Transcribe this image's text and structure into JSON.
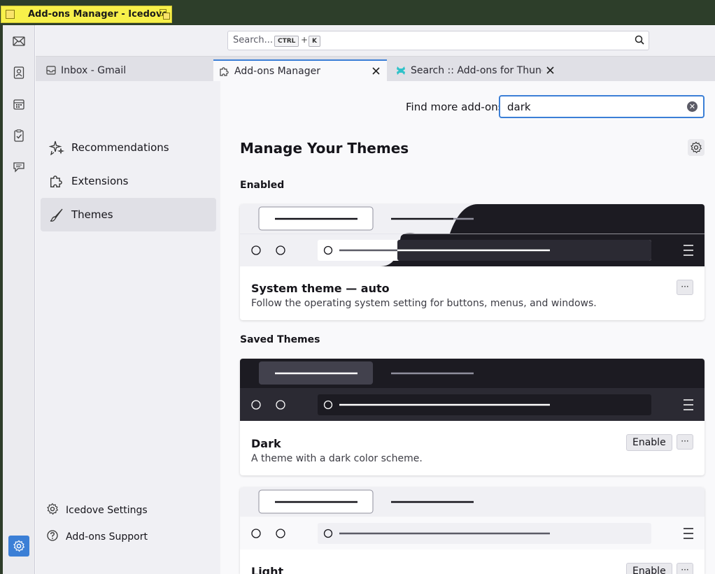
{
  "window": {
    "title": "Add-ons Manager - Icedove"
  },
  "spaces": [
    "mail-icon",
    "address-book-icon",
    "calendar-icon",
    "tasks-icon",
    "chat-icon",
    "settings-icon"
  ],
  "toolbar": {
    "search_placeholder": "Search...",
    "shortcut_key1": "CTRL",
    "shortcut_plus": "+",
    "shortcut_key2": "K"
  },
  "tabs": [
    {
      "label": "Inbox - Gmail",
      "icon": "inbox-icon"
    },
    {
      "label": "Add-ons Manager",
      "icon": "puzzle-icon",
      "active": true
    },
    {
      "label": "Search :: Add-ons for Thunderbird",
      "icon": "addons-site-icon"
    }
  ],
  "sidebar": {
    "categories": [
      {
        "label": "Recommendations",
        "icon": "sparkle-icon"
      },
      {
        "label": "Extensions",
        "icon": "puzzle-icon"
      },
      {
        "label": "Themes",
        "icon": "brush-icon",
        "selected": true
      }
    ],
    "footer": [
      {
        "label": "Icedove Settings",
        "icon": "gear-icon"
      },
      {
        "label": "Add-ons Support",
        "icon": "help-icon"
      }
    ]
  },
  "main": {
    "find_label": "Find more add-ons",
    "find_value": "dark",
    "heading": "Manage Your Themes",
    "enabled_heading": "Enabled",
    "saved_heading": "Saved Themes",
    "more_label": "···",
    "themes": [
      {
        "name": "System theme — auto",
        "description": "Follow the operating system setting for buttons, menus, and windows."
      },
      {
        "name": "Dark",
        "description": "A theme with a dark color scheme.",
        "action": "Enable"
      },
      {
        "name": "Light",
        "description": "",
        "action": "Enable"
      }
    ]
  },
  "colors": {
    "accent": "#3b7fd6",
    "dark_preview": "#1c1b22",
    "light_preview": "#f0f0f4"
  }
}
